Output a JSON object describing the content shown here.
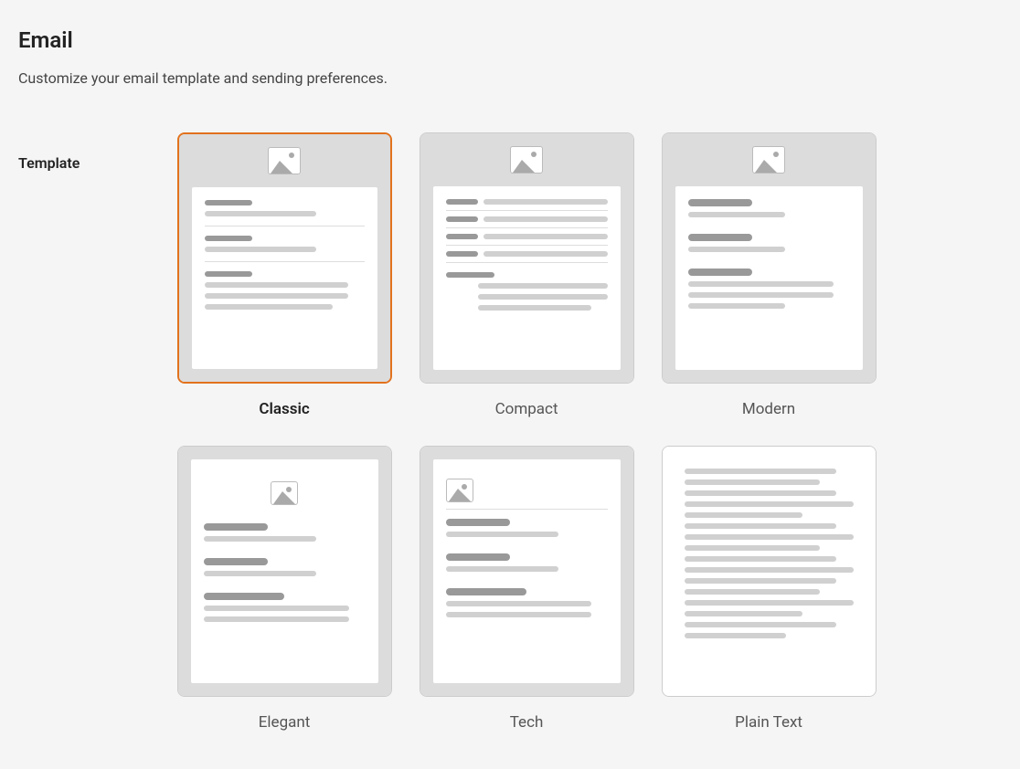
{
  "page": {
    "title": "Email",
    "subtitle": "Customize your email template and sending preferences."
  },
  "section": {
    "template_label": "Template"
  },
  "templates": [
    {
      "id": "classic",
      "label": "Classic",
      "selected": true
    },
    {
      "id": "compact",
      "label": "Compact",
      "selected": false
    },
    {
      "id": "modern",
      "label": "Modern",
      "selected": false
    },
    {
      "id": "elegant",
      "label": "Elegant",
      "selected": false
    },
    {
      "id": "tech",
      "label": "Tech",
      "selected": false
    },
    {
      "id": "plaintext",
      "label": "Plain Text",
      "selected": false
    }
  ],
  "colors": {
    "accent": "#e2721d"
  }
}
